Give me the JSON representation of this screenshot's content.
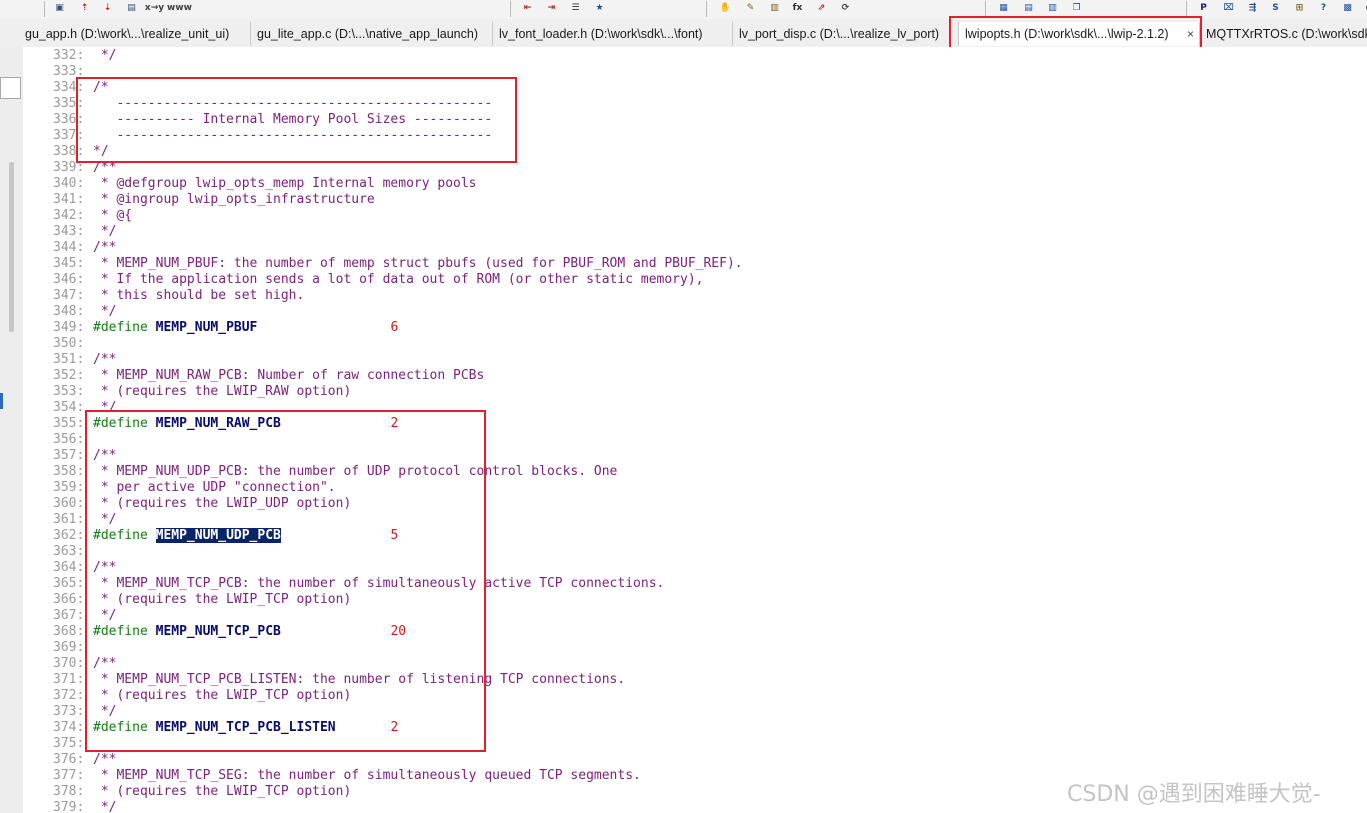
{
  "toolbar": {
    "buttons": [
      {
        "name": "find-icon",
        "glyph": "▣",
        "color": "#30507a"
      },
      {
        "name": "find-up-icon",
        "glyph": "⇡",
        "color": "#c02020"
      },
      {
        "name": "find-down-icon",
        "glyph": "⇣",
        "color": "#c02020"
      },
      {
        "name": "find-in-files-icon",
        "glyph": "▤",
        "color": "#30507a"
      },
      {
        "name": "replace-icon",
        "glyph": "x→y",
        "color": "#404040"
      },
      {
        "name": "web-icon",
        "glyph": "www",
        "color": "#404040"
      },
      {
        "name": "bookmark-prev-icon",
        "glyph": "⇤",
        "color": "#c02020"
      },
      {
        "name": "bookmark-next-icon",
        "glyph": "⇥",
        "color": "#c02020"
      },
      {
        "name": "indent-icon",
        "glyph": "☰",
        "color": "#303030"
      },
      {
        "name": "favorites-icon",
        "glyph": "★",
        "color": "#2050a0"
      },
      {
        "name": "hand-icon",
        "glyph": "✋",
        "color": "#806020"
      },
      {
        "name": "new-function-icon",
        "glyph": "✎",
        "color": "#806020"
      },
      {
        "name": "book-icon",
        "glyph": "▥",
        "color": "#806020"
      },
      {
        "name": "function-icon",
        "glyph": "fx",
        "color": "#303030"
      },
      {
        "name": "jump-icon",
        "glyph": "⇗",
        "color": "#c02020"
      },
      {
        "name": "refresh-icon",
        "glyph": "⟳",
        "color": "#404040"
      },
      {
        "name": "layout-1-icon",
        "glyph": "▦",
        "color": "#2050a0"
      },
      {
        "name": "layout-2-icon",
        "glyph": "▤",
        "color": "#2050a0"
      },
      {
        "name": "layout-3-icon",
        "glyph": "▥",
        "color": "#2050a0"
      },
      {
        "name": "window-icon",
        "glyph": "❐",
        "color": "#2050a0"
      },
      {
        "name": "project-icon",
        "glyph": "P",
        "color": "#1a1a8a"
      },
      {
        "name": "relation-icon",
        "glyph": "⌧",
        "color": "#2050a0"
      },
      {
        "name": "symbol-tree-icon",
        "glyph": "⇶",
        "color": "#2050a0"
      },
      {
        "name": "symbol-icon",
        "glyph": "S",
        "color": "#2050a0"
      },
      {
        "name": "context-icon",
        "glyph": "⊞",
        "color": "#806020"
      },
      {
        "name": "help-icon",
        "glyph": "?",
        "color": "#2050a0"
      },
      {
        "name": "chart-icon",
        "glyph": "▩",
        "color": "#2050a0"
      },
      {
        "name": "overflow-icon",
        "glyph": "◐",
        "color": "#404040"
      }
    ]
  },
  "tabs": [
    {
      "label": "gu_app.h (D:\\work\\...\\realize_unit_ui)",
      "active": false
    },
    {
      "label": "gu_lite_app.c (D:\\...\\native_app_launch)",
      "active": false
    },
    {
      "label": "lv_font_loader.h (D:\\work\\sdk\\...\\font)",
      "active": false
    },
    {
      "label": "lv_port_disp.c (D:\\...\\realize_lv_port)",
      "active": false
    },
    {
      "label": "lwipopts.h (D:\\work\\sdk\\...\\lwip-2.1.2)",
      "active": true,
      "close_glyph": "×"
    },
    {
      "label": "MQTTXrRTOS.c (D:\\work\\sdk",
      "active": false
    }
  ],
  "code_lines": [
    {
      "num": "332:",
      "tokens": [
        {
          "t": " */",
          "k": "comment"
        }
      ]
    },
    {
      "num": "333:",
      "tokens": []
    },
    {
      "num": "334:",
      "tokens": [
        {
          "t": "/*",
          "k": "comment"
        }
      ]
    },
    {
      "num": "335:",
      "tokens": [
        {
          "t": "   ------------------------------------------------",
          "k": "comment"
        }
      ]
    },
    {
      "num": "336:",
      "tokens": [
        {
          "t": "   ---------- Internal Memory Pool Sizes ----------",
          "k": "comment"
        }
      ]
    },
    {
      "num": "337:",
      "tokens": [
        {
          "t": "   ------------------------------------------------",
          "k": "comment"
        }
      ]
    },
    {
      "num": "338:",
      "tokens": [
        {
          "t": "*/",
          "k": "comment"
        }
      ]
    },
    {
      "num": "339:",
      "tokens": [
        {
          "t": "/**",
          "k": "comment"
        }
      ]
    },
    {
      "num": "340:",
      "tokens": [
        {
          "t": " * @defgroup lwip_opts_memp Internal memory pools",
          "k": "comment"
        }
      ]
    },
    {
      "num": "341:",
      "tokens": [
        {
          "t": " * @ingroup lwip_opts_infrastructure",
          "k": "comment"
        }
      ]
    },
    {
      "num": "342:",
      "tokens": [
        {
          "t": " * @{",
          "k": "comment"
        }
      ]
    },
    {
      "num": "343:",
      "tokens": [
        {
          "t": " */",
          "k": "comment"
        }
      ]
    },
    {
      "num": "344:",
      "tokens": [
        {
          "t": "/**",
          "k": "comment"
        }
      ]
    },
    {
      "num": "345:",
      "tokens": [
        {
          "t": " * MEMP_NUM_PBUF: the number of memp struct pbufs (used for PBUF_ROM and PBUF_REF).",
          "k": "comment"
        }
      ]
    },
    {
      "num": "346:",
      "tokens": [
        {
          "t": " * If the application sends a lot of data out of ROM (or other static memory),",
          "k": "comment"
        }
      ]
    },
    {
      "num": "347:",
      "tokens": [
        {
          "t": " * this should be set high.",
          "k": "comment"
        }
      ]
    },
    {
      "num": "348:",
      "tokens": [
        {
          "t": " */",
          "k": "comment"
        }
      ]
    },
    {
      "num": "349:",
      "tokens": [
        {
          "t": "#define ",
          "k": "directive"
        },
        {
          "t": "MEMP_NUM_PBUF",
          "k": "macro"
        },
        {
          "t": "                 ",
          "k": "plain"
        },
        {
          "t": "6",
          "k": "number"
        }
      ]
    },
    {
      "num": "350:",
      "tokens": []
    },
    {
      "num": "351:",
      "tokens": [
        {
          "t": "/**",
          "k": "comment"
        }
      ]
    },
    {
      "num": "352:",
      "tokens": [
        {
          "t": " * MEMP_NUM_RAW_PCB: Number of raw connection PCBs",
          "k": "comment"
        }
      ]
    },
    {
      "num": "353:",
      "tokens": [
        {
          "t": " * (requires the LWIP_RAW option)",
          "k": "comment"
        }
      ]
    },
    {
      "num": "354:",
      "tokens": [
        {
          "t": " */",
          "k": "comment"
        }
      ]
    },
    {
      "num": "355:",
      "tokens": [
        {
          "t": "#define ",
          "k": "directive"
        },
        {
          "t": "MEMP_NUM_RAW_PCB",
          "k": "macro"
        },
        {
          "t": "              ",
          "k": "plain"
        },
        {
          "t": "2",
          "k": "number"
        }
      ]
    },
    {
      "num": "356:",
      "tokens": []
    },
    {
      "num": "357:",
      "tokens": [
        {
          "t": "/**",
          "k": "comment"
        }
      ]
    },
    {
      "num": "358:",
      "tokens": [
        {
          "t": " * MEMP_NUM_UDP_PCB: the number of UDP protocol control blocks. One",
          "k": "comment"
        }
      ]
    },
    {
      "num": "359:",
      "tokens": [
        {
          "t": " * per active UDP \"connection\".",
          "k": "comment"
        }
      ]
    },
    {
      "num": "360:",
      "tokens": [
        {
          "t": " * (requires the LWIP_UDP option)",
          "k": "comment"
        }
      ]
    },
    {
      "num": "361:",
      "tokens": [
        {
          "t": " */",
          "k": "comment"
        }
      ]
    },
    {
      "num": "362:",
      "tokens": [
        {
          "t": "#define ",
          "k": "directive"
        },
        {
          "t": "MEMP_NUM_UDP_PCB",
          "k": "macro-selected"
        },
        {
          "t": "              ",
          "k": "plain"
        },
        {
          "t": "5",
          "k": "number"
        }
      ]
    },
    {
      "num": "363:",
      "tokens": []
    },
    {
      "num": "364:",
      "tokens": [
        {
          "t": "/**",
          "k": "comment"
        }
      ]
    },
    {
      "num": "365:",
      "tokens": [
        {
          "t": " * MEMP_NUM_TCP_PCB: the number of simultaneously active TCP connections.",
          "k": "comment"
        }
      ]
    },
    {
      "num": "366:",
      "tokens": [
        {
          "t": " * (requires the LWIP_TCP option)",
          "k": "comment"
        }
      ]
    },
    {
      "num": "367:",
      "tokens": [
        {
          "t": " */",
          "k": "comment"
        }
      ]
    },
    {
      "num": "368:",
      "tokens": [
        {
          "t": "#define ",
          "k": "directive"
        },
        {
          "t": "MEMP_NUM_TCP_PCB",
          "k": "macro"
        },
        {
          "t": "              ",
          "k": "plain"
        },
        {
          "t": "20",
          "k": "number"
        }
      ]
    },
    {
      "num": "369:",
      "tokens": []
    },
    {
      "num": "370:",
      "tokens": [
        {
          "t": "/**",
          "k": "comment"
        }
      ]
    },
    {
      "num": "371:",
      "tokens": [
        {
          "t": " * MEMP_NUM_TCP_PCB_LISTEN: the number of listening TCP connections.",
          "k": "comment"
        }
      ]
    },
    {
      "num": "372:",
      "tokens": [
        {
          "t": " * (requires the LWIP_TCP option)",
          "k": "comment"
        }
      ]
    },
    {
      "num": "373:",
      "tokens": [
        {
          "t": " */",
          "k": "comment"
        }
      ]
    },
    {
      "num": "374:",
      "tokens": [
        {
          "t": "#define ",
          "k": "directive"
        },
        {
          "t": "MEMP_NUM_TCP_PCB_LISTEN",
          "k": "macro"
        },
        {
          "t": "       ",
          "k": "plain"
        },
        {
          "t": "2",
          "k": "number"
        }
      ]
    },
    {
      "num": "375:",
      "tokens": []
    },
    {
      "num": "376:",
      "tokens": [
        {
          "t": "/**",
          "k": "comment"
        }
      ]
    },
    {
      "num": "377:",
      "tokens": [
        {
          "t": " * MEMP_NUM_TCP_SEG: the number of simultaneously queued TCP segments.",
          "k": "comment"
        }
      ]
    },
    {
      "num": "378:",
      "tokens": [
        {
          "t": " * (requires the LWIP_TCP option)",
          "k": "comment"
        }
      ]
    },
    {
      "num": "379:",
      "tokens": [
        {
          "t": " */",
          "k": "comment"
        }
      ]
    }
  ],
  "colors": {
    "comment": "#7f207f",
    "directive": "#0e7f0e",
    "macro": "#0a0a6e",
    "number": "#d01b1b",
    "selection": "#0a246a",
    "annotation_box": "#e0202a"
  },
  "watermark": "CSDN @遇到困难睡大觉-"
}
